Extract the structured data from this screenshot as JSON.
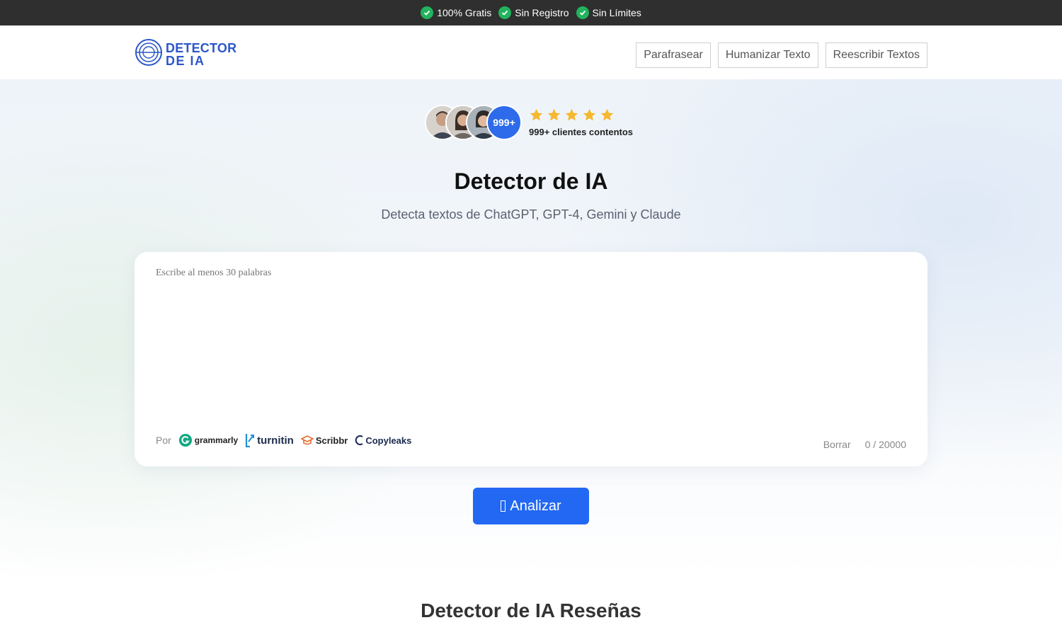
{
  "topbar": {
    "features": [
      "100% Gratis",
      "Sin Registro",
      "Sin Límites"
    ]
  },
  "header": {
    "logo_line1": "DETECTOR",
    "logo_line2": "DE IA",
    "nav": [
      "Parafrasear",
      "Humanizar Texto",
      "Reescribir Textos"
    ]
  },
  "hero": {
    "avatar_count": "999+",
    "rating_stars": 5,
    "rating_text": "999+ clientes contentos",
    "title": "Detector de IA",
    "subtitle": "Detecta textos de ChatGPT, GPT-4, Gemini y Claude"
  },
  "editor": {
    "placeholder": "Escribe al menos 30 palabras",
    "value": "",
    "by_label": "Por",
    "brands": [
      "grammarly",
      "turnitin",
      "Scribbr",
      "Copyleaks"
    ],
    "clear_label": "Borrar",
    "counter": "0 / 20000"
  },
  "analyze": {
    "label": "Analizar"
  },
  "reviews": {
    "title": "Detector de IA Reseñas"
  },
  "colors": {
    "accent": "#2268f2",
    "brand_blue": "#2b57c9",
    "check_green": "#22b35e",
    "star": "#f5b82e"
  }
}
